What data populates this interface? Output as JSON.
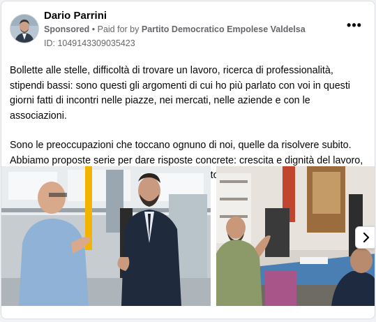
{
  "post": {
    "author": "Dario Parrini",
    "sponsored_label": "Sponsored",
    "paid_for_prefix": " • Paid for by ",
    "payer": "Partito Democratico Empolese Valdelsa",
    "id_label": "ID: 1049143309035423",
    "more_icon": "•••",
    "paragraph1": "Bollette alle stelle, difficoltà di trovare un lavoro, ricerca di professionalità, stipendi bassi: sono questi gli argomenti di cui ho più parlato con voi in questi giorni fatti di incontri nelle piazze, nei mercati, nelle aziende e con le associazioni.",
    "paragraph2": "Sono le preoccupazioni che toccano ognuno di noi, quelle da risolvere subito. Abbiamo proposte serie per dare risposte concrete: crescita e dignità del lavoro, sostegno alle imprese, diritti sociali e civili, tetto al prezzo del gas. Basta sceglier…"
  },
  "carousel": {
    "next_icon": "chevron-right-icon"
  },
  "colors": {
    "text_primary": "#050505",
    "text_secondary": "#65676b",
    "card_border": "#dddfe2"
  }
}
